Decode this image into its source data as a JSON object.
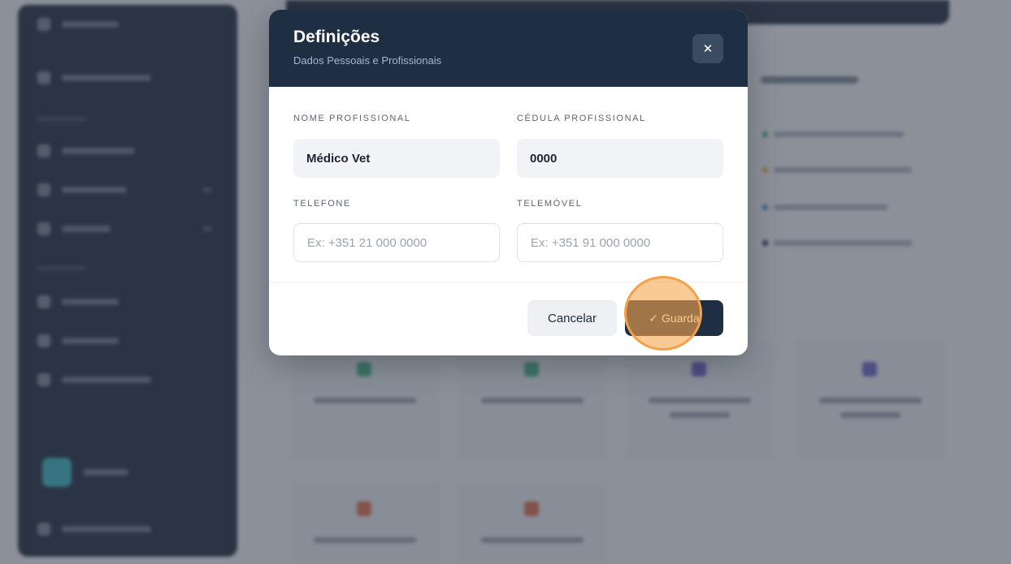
{
  "modal": {
    "title": "Definições",
    "subtitle": "Dados Pessoais e Profissionais",
    "close_icon": "close-icon",
    "fields": {
      "nome_profissional": {
        "label": "NOME PROFISSIONAL",
        "value": "Médico Vet"
      },
      "cedula_profissional": {
        "label": "CÉDULA PROFISSIONAL",
        "value": "0000"
      },
      "telefone": {
        "label": "TELEFONE",
        "placeholder": "Ex: +351 21 000 0000"
      },
      "telemovel": {
        "label": "TELEMÓVEL",
        "placeholder": "Ex: +351 91 000 0000"
      }
    },
    "buttons": {
      "cancel_label": "Cancelar",
      "save_label": "Guarda",
      "save_icon": "check-icon"
    }
  },
  "colors": {
    "header_bg": "#1e2f44",
    "sidebar_bg": "#1e2c3d",
    "click_highlight": "#f5a04a"
  }
}
